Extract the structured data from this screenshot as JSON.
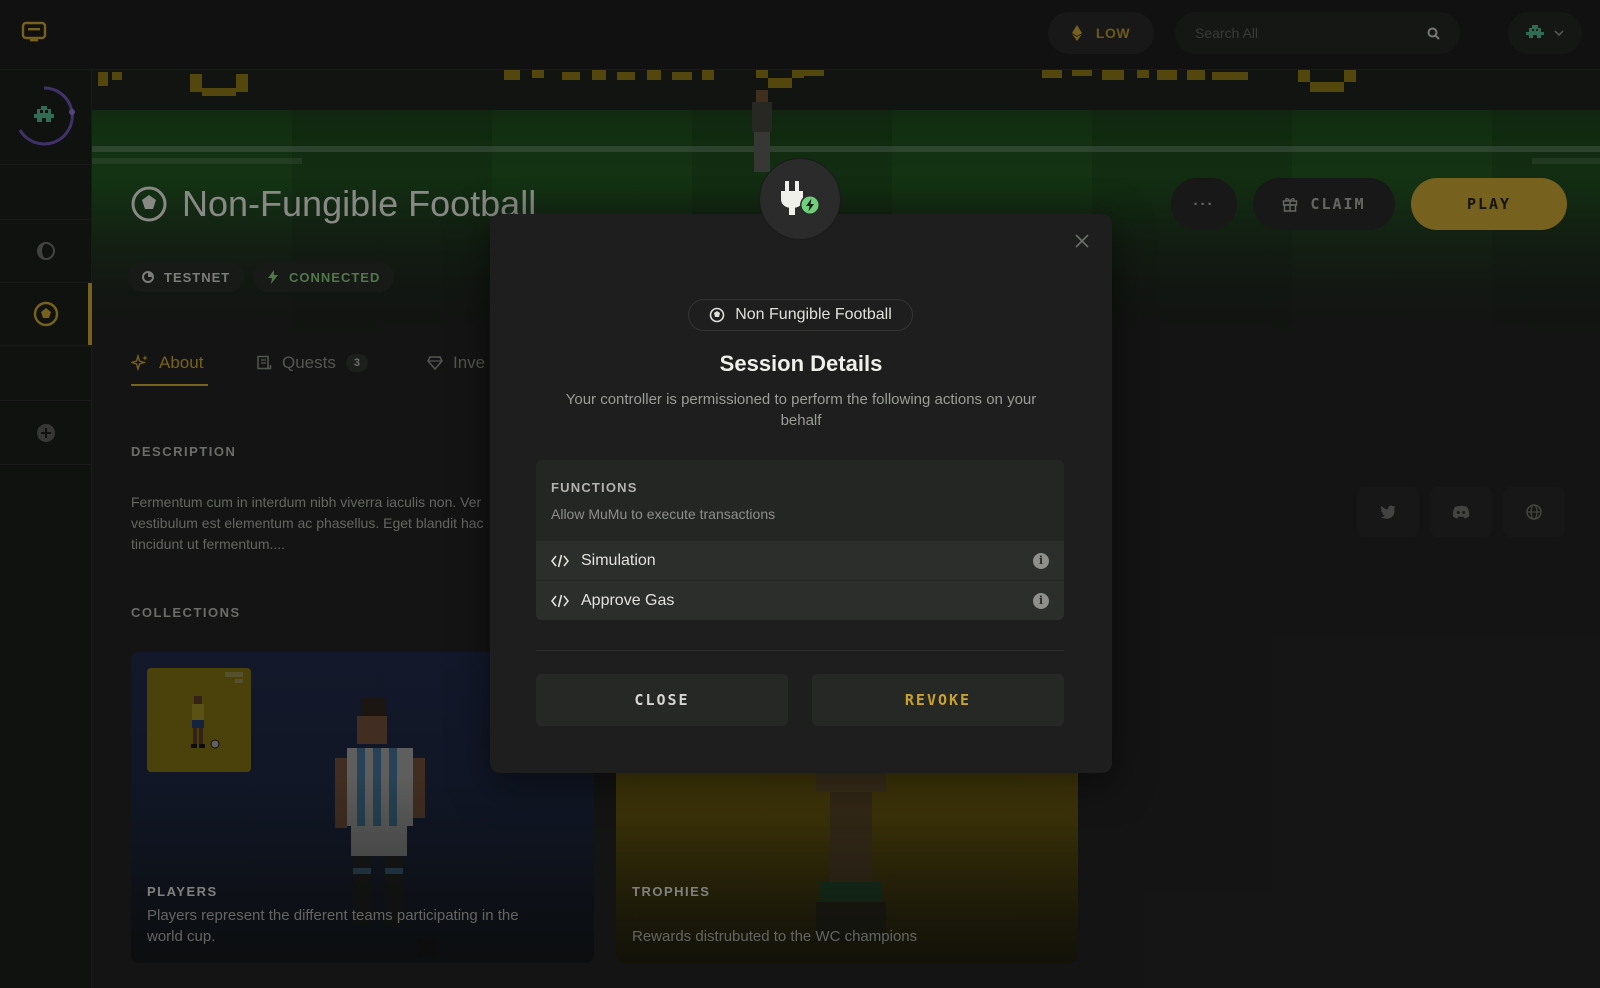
{
  "topbar": {
    "gas_label": "LOW",
    "search_placeholder": "Search All"
  },
  "game": {
    "title": "Non-Fungible Football",
    "badges": {
      "network": "TESTNET",
      "status": "CONNECTED"
    },
    "actions": {
      "more": "···",
      "claim": "CLAIM",
      "play": "PLAY"
    }
  },
  "tabs": [
    {
      "label": "About"
    },
    {
      "label": "Quests",
      "count": "3"
    },
    {
      "label": "Inve"
    }
  ],
  "about": {
    "description_label": "DESCRIPTION",
    "description_lines": [
      "Fermentum cum in interdum nibh viverra iaculis non. Ver",
      "vestibulum est elementum ac phasellus. Eget blandit hac",
      "tincidunt ut fermentum...."
    ],
    "collections_label": "COLLECTIONS",
    "collections": [
      {
        "title": "PLAYERS",
        "text": "Players represent the different teams participating in the world cup."
      },
      {
        "title": "TROPHIES",
        "text": "Rewards distrubuted to the WC champions"
      }
    ]
  },
  "modal": {
    "app_name": "Non Fungible Football",
    "title": "Session Details",
    "subtitle": "Your controller is permissioned to perform the following actions on your behalf",
    "functions_label": "FUNCTIONS",
    "functions_desc": "Allow MuMu to execute transactions",
    "functions": [
      {
        "label": "Simulation"
      },
      {
        "label": "Approve Gas"
      }
    ],
    "close_label": "CLOSE",
    "revoke_label": "REVOKE"
  },
  "colors": {
    "accent": "#c9a12f",
    "connected": "#86c77a",
    "background": "#1c1d1c",
    "modal": "#1d1e1d"
  },
  "icons": [
    "logo-icon",
    "eth-icon",
    "search-icon",
    "account-icon",
    "chevron-down-icon",
    "avatar-icon",
    "moon-icon",
    "football-icon",
    "plus-icon",
    "globe-spinner-icon",
    "bolt-icon",
    "sparkle-icon",
    "scroll-icon",
    "gem-icon",
    "gift-icon",
    "twitter-icon",
    "discord-icon",
    "globe-icon",
    "plug-icon",
    "close-icon",
    "code-icon",
    "info-icon"
  ]
}
